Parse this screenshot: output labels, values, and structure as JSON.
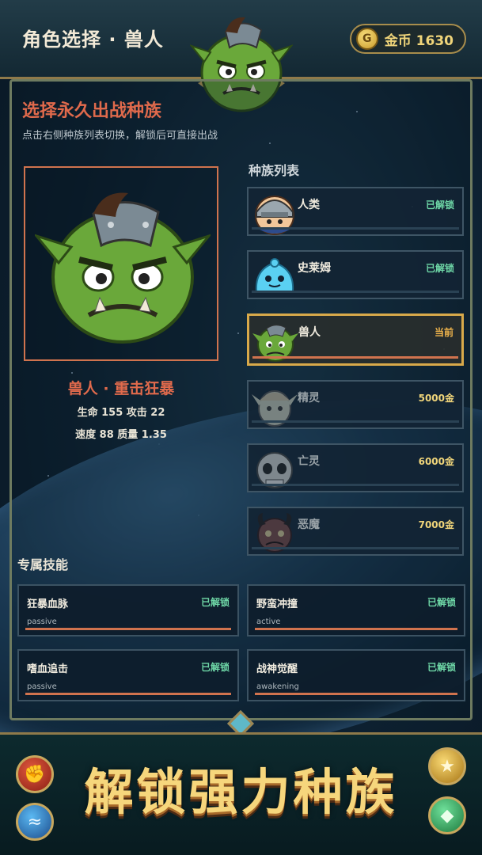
{
  "header": {
    "title": "角色选择 · 兽人",
    "coin_label": "金币 1630",
    "coin_icon": "coin-icon"
  },
  "selection": {
    "title": "选择永久出战种族",
    "subtitle": "点击右侧种族列表切换，解锁后可直接出战",
    "race_line": "兽人 · 重击狂暴",
    "stats_line1": "生命 155  攻击 22",
    "stats_line2": "速度 88  质量 1.35"
  },
  "race_list": {
    "title": "种族列表",
    "items": [
      {
        "name": "人类",
        "status": "已解锁",
        "state": "unlocked",
        "icon": "knight-avatar-icon"
      },
      {
        "name": "史莱姆",
        "status": "已解锁",
        "state": "unlocked",
        "icon": "slime-avatar-icon"
      },
      {
        "name": "兽人",
        "status": "当前",
        "state": "current",
        "icon": "orc-avatar-icon"
      },
      {
        "name": "精灵",
        "status": "5000金",
        "state": "locked",
        "icon": "elf-avatar-icon"
      },
      {
        "name": "亡灵",
        "status": "6000金",
        "state": "locked",
        "icon": "undead-avatar-icon"
      },
      {
        "name": "恶魔",
        "status": "7000金",
        "state": "locked",
        "icon": "demon-avatar-icon"
      }
    ]
  },
  "skills": {
    "title": "专属技能",
    "items": [
      {
        "name": "狂暴血脉",
        "status": "已解锁",
        "type": "passive"
      },
      {
        "name": "野蛮冲撞",
        "status": "已解锁",
        "type": "active"
      },
      {
        "name": "嗜血追击",
        "status": "已解锁",
        "type": "passive"
      },
      {
        "name": "战神觉醒",
        "status": "已解锁",
        "type": "awakening"
      }
    ]
  },
  "banner": {
    "text": "解锁强力种族"
  },
  "colors": {
    "accent": "#e06a4c",
    "gold": "#f0d57a",
    "unlocked": "#6ed6a6",
    "current": "#f0b54c",
    "orc_skin": "#6aa83a"
  }
}
